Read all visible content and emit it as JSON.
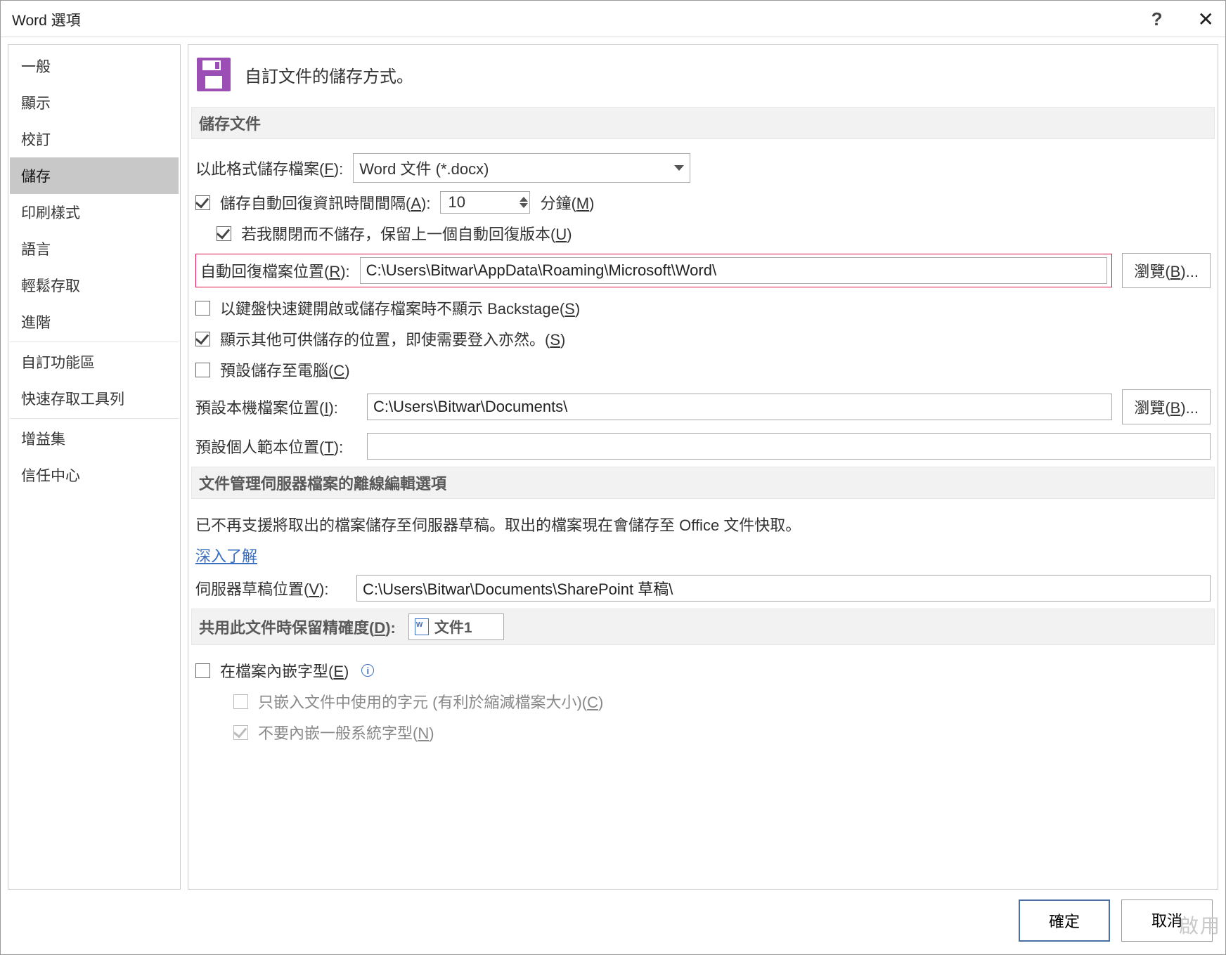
{
  "title": "Word 選項",
  "sidebar": {
    "items": [
      {
        "label": "一般"
      },
      {
        "label": "顯示"
      },
      {
        "label": "校訂"
      },
      {
        "label": "儲存"
      },
      {
        "label": "印刷樣式"
      },
      {
        "label": "語言"
      },
      {
        "label": "輕鬆存取"
      },
      {
        "label": "進階"
      },
      {
        "label": "自訂功能區"
      },
      {
        "label": "快速存取工具列"
      },
      {
        "label": "增益集"
      },
      {
        "label": "信任中心"
      }
    ],
    "selected_index": 3
  },
  "heading": "自訂文件的儲存方式。",
  "section_save": {
    "title": "儲存文件",
    "format_label_pre": "以此格式儲存檔案(",
    "format_key": "F",
    "format_label_post": "):",
    "format_value": "Word 文件 (*.docx)",
    "autorecover_label_pre": "儲存自動回復資訊時間間隔(",
    "autorecover_key": "A",
    "autorecover_label_post": "):",
    "autorecover_value": "10",
    "minutes_pre": "分鐘(",
    "minutes_key": "M",
    "minutes_post": ")",
    "keep_last_pre": "若我關閉而不儲存，保留上一個自動回復版本(",
    "keep_last_key": "U",
    "keep_last_post": ")",
    "autorecover_loc_label_pre": "自動回復檔案位置(",
    "autorecover_loc_key": "R",
    "autorecover_loc_label_post": "):",
    "autorecover_loc_value": "C:\\Users\\Bitwar\\AppData\\Roaming\\Microsoft\\Word\\",
    "browse1_pre": "瀏覽(",
    "browse1_key": "B",
    "browse1_post": ")...",
    "no_backstage_pre": "以鍵盤快速鍵開啟或儲存檔案時不顯示 Backstage(",
    "no_backstage_key": "S",
    "no_backstage_post": ")",
    "show_other_pre": "顯示其他可供儲存的位置，即使需要登入亦然。(",
    "show_other_key": "S",
    "show_other_post": ")",
    "save_to_pc_pre": "預設儲存至電腦(",
    "save_to_pc_key": "C",
    "save_to_pc_post": ")",
    "default_loc_label_pre": "預設本機檔案位置(",
    "default_loc_key": "I",
    "default_loc_label_post": "):",
    "default_loc_value": "C:\\Users\\Bitwar\\Documents\\",
    "browse2_pre": "瀏覽(",
    "browse2_key": "B",
    "browse2_post": ")...",
    "template_loc_label_pre": "預設個人範本位置(",
    "template_loc_key": "T",
    "template_loc_label_post": "):",
    "template_loc_value": ""
  },
  "section_offline": {
    "title": "文件管理伺服器檔案的離線編輯選項",
    "note": "已不再支援將取出的檔案儲存至伺服器草稿。取出的檔案現在會儲存至 Office 文件快取。",
    "learn_more": "深入了解",
    "drafts_label_pre": "伺服器草稿位置(",
    "drafts_key": "V",
    "drafts_label_post": "):",
    "drafts_value": "C:\\Users\\Bitwar\\Documents\\SharePoint 草稿\\"
  },
  "section_share": {
    "title_pre": "共用此文件時保留精確度(",
    "title_key": "D",
    "title_post": "):",
    "doc_name": "文件1",
    "embed_fonts_pre": "在檔案內嵌字型(",
    "embed_fonts_key": "E",
    "embed_fonts_post": ")",
    "only_chars_pre": "只嵌入文件中使用的字元 (有利於縮減檔案大小)(",
    "only_chars_key": "C",
    "only_chars_post": ")",
    "no_system_fonts_pre": "不要內嵌一般系統字型(",
    "no_system_fonts_key": "N",
    "no_system_fonts_post": ")"
  },
  "footer": {
    "ok": "確定",
    "cancel": "取消"
  },
  "watermark": "啟用"
}
